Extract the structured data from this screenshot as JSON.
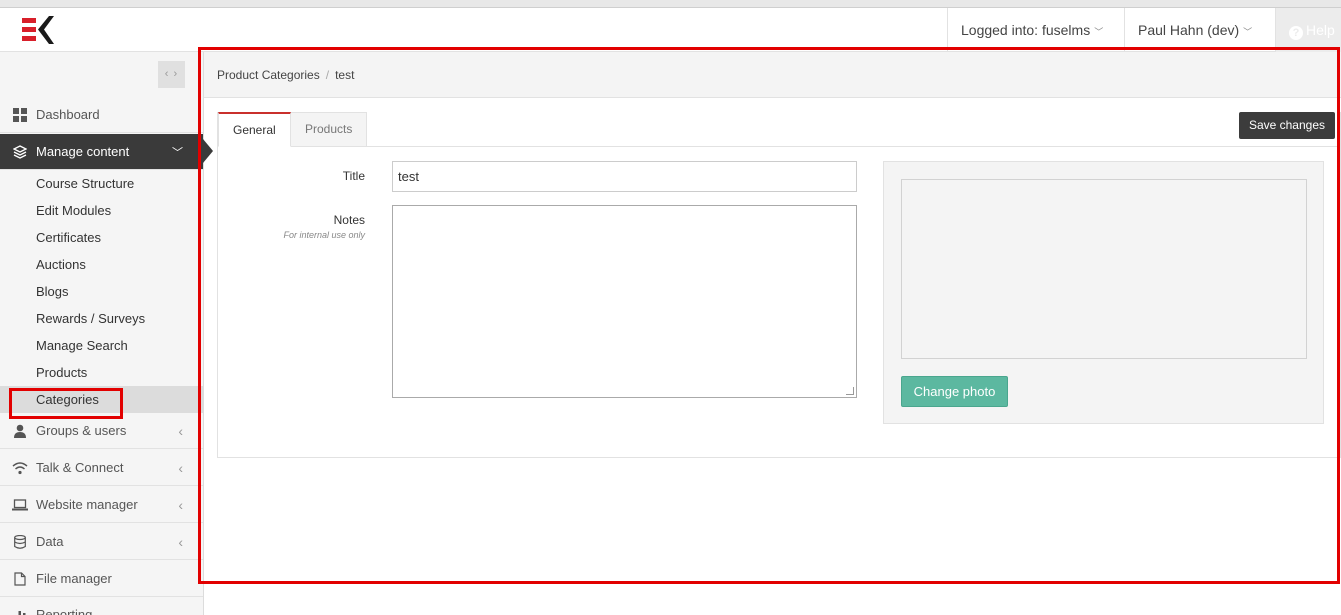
{
  "topbar": {
    "logged_into": "Logged into: fuselms",
    "user": "Paul Hahn (dev)",
    "help": "Help"
  },
  "sidebar": {
    "collapse_label": "‹ ›",
    "nav": {
      "dashboard": "Dashboard",
      "manage_content": "Manage content",
      "groups_users": "Groups & users",
      "talk_connect": "Talk & Connect",
      "website_manager": "Website manager",
      "data": "Data",
      "file_manager": "File manager",
      "reporting": "Reporting"
    },
    "sub": {
      "course_structure": "Course Structure",
      "edit_modules": "Edit Modules",
      "certificates": "Certificates",
      "auctions": "Auctions",
      "blogs": "Blogs",
      "rewards_surveys": "Rewards / Surveys",
      "manage_search": "Manage Search",
      "products": "Products",
      "categories": "Categories"
    }
  },
  "breadcrumb": {
    "parent": "Product Categories",
    "separator": "/",
    "current": "test"
  },
  "tabs": {
    "general": "General",
    "products": "Products"
  },
  "toolbar": {
    "save_label": "Save changes"
  },
  "form": {
    "title_label": "Title",
    "title_value": "test",
    "notes_label": "Notes",
    "notes_hint": "For internal use only",
    "notes_value": ""
  },
  "photo": {
    "change_label": "Change photo"
  },
  "colors": {
    "accent_red": "#e20000",
    "sidebar_active": "#3a3a3a",
    "photo_button": "#5cb8a0",
    "save_button": "#3c3c3c"
  }
}
